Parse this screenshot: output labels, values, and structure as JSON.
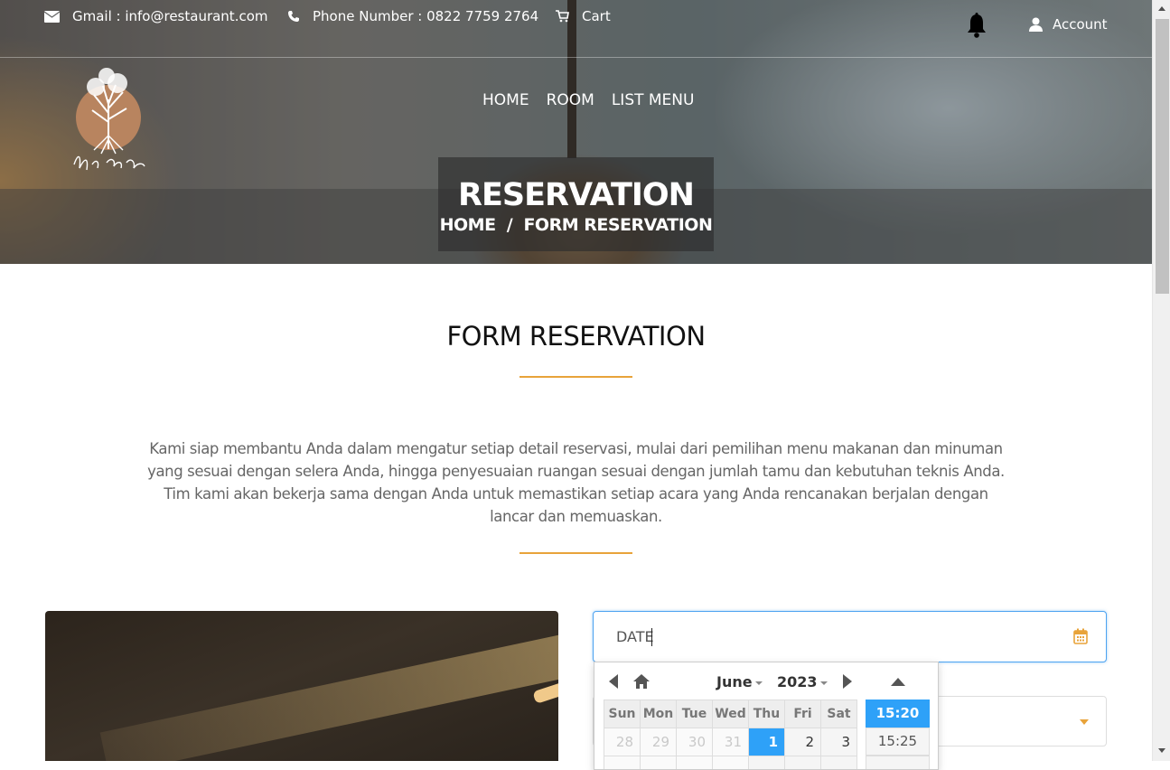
{
  "topbar": {
    "email": "Gmail : info@restaurant.com",
    "phone": "Phone Number : 0822 7759 2764",
    "cart": "Cart",
    "account": "Account"
  },
  "nav": [
    "HOME",
    "ROOM",
    "LIST MENU"
  ],
  "hero": {
    "title": "RESERVATION",
    "breadcrumb": "HOME  /  FORM RESERVATION"
  },
  "section": {
    "heading": "FORM RESERVATION",
    "description": "Kami siap membantu Anda dalam mengatur setiap detail reservasi, mulai dari pemilihan menu makanan dan minuman yang sesuai dengan selera Anda, hingga penyesuaian ruangan sesuai dengan jumlah tamu dan kebutuhan teknis Anda. Tim kami akan bekerja sama dengan Anda untuk memastikan setiap acara yang Anda rencanakan berjalan dengan lancar dan memuaskan."
  },
  "form": {
    "date_value": "DATE"
  },
  "datepicker": {
    "month": "June",
    "year": "2023",
    "weekdays": [
      "Sun",
      "Mon",
      "Tue",
      "Wed",
      "Thu",
      "Fri",
      "Sat"
    ],
    "week1": [
      "28",
      "29",
      "30",
      "31",
      "1",
      "2",
      "3"
    ],
    "selected_day": "1",
    "times": [
      "15:20",
      "15:25"
    ],
    "selected_time": "15:20"
  },
  "colors": {
    "accent": "#e8a33a",
    "picker_highlight": "#2ea1f8",
    "focus_border": "#4da3f0"
  },
  "icons": [
    "envelope-icon",
    "phone-icon",
    "cart-icon",
    "bell-icon",
    "user-icon",
    "calendar-icon",
    "home-icon",
    "chevron-left-icon",
    "chevron-right-icon",
    "chevron-up-icon",
    "dropdown-arrow-icon"
  ]
}
